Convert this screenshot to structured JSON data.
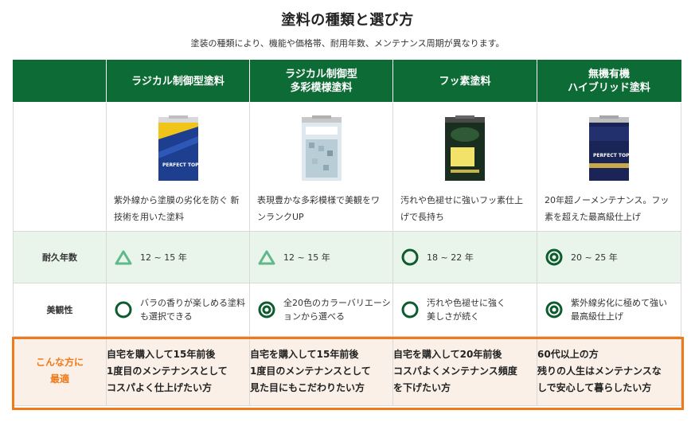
{
  "title": "塗料の種類と選び方",
  "subtitle": "塗装の種類により、機能や価格帯、耐用年数、メンテナンス周期が異なります。",
  "colors": {
    "header_green": "#0d6b35",
    "accent_orange": "#f07a1a",
    "durability_row_bg": "#e9f4ea",
    "best_row_bg": "#faf0e8"
  },
  "row_labels": {
    "durability": "耐久年数",
    "beauty": "美観性",
    "best_for": "こんな方に\n最適"
  },
  "columns": [
    {
      "header": "ラジカル制御型塗料",
      "can_label": "PERFECT TOP",
      "description": "紫外線から塗膜の劣化を防ぐ 新技術を用いた塗料",
      "durability": {
        "icon": "triangle-icon",
        "text": "12 ~ 15 年"
      },
      "beauty": {
        "icon": "circle-icon",
        "text": "バラの香りが楽しめる塗料も選択できる"
      },
      "best_for": "自宅を購入して15年前後\n1度目のメンテナンスとして\nコスパよく仕上げたい方"
    },
    {
      "header": "ラジカル制御型\n多彩模様塗料",
      "can_label": "",
      "description": "表現豊かな多彩模様で美観をワンランクUP",
      "durability": {
        "icon": "triangle-icon",
        "text": "12 ~ 15 年"
      },
      "beauty": {
        "icon": "double-circle-icon",
        "text": "全20色のカラーバリエーションから選べる"
      },
      "best_for": "自宅を購入して15年前後\n1度目のメンテナンスとして\n見た目にもこだわりたい方"
    },
    {
      "header": "フッ素塗料",
      "can_label": "",
      "description": "汚れや色褪せに強いフッ素仕上げで長持ち",
      "durability": {
        "icon": "circle-icon",
        "text": "18 ~ 22 年"
      },
      "beauty": {
        "icon": "circle-icon",
        "text": "汚れや色褪せに強く\n美しさが続く"
      },
      "best_for": "自宅を購入して20年前後\nコスパよくメンテナンス頻度\nを下げたい方"
    },
    {
      "header": "無機有機\nハイブリッド塗料",
      "can_label": "PERFECT TOP",
      "description": "20年超ノーメンテナンス。フッ素を超えた最高級仕上げ",
      "durability": {
        "icon": "double-circle-icon",
        "text": "20 ~ 25 年"
      },
      "beauty": {
        "icon": "double-circle-icon",
        "text": "紫外線劣化に極めて強い\n最高級仕上げ"
      },
      "best_for": "60代以上の方\n残りの人生はメンテナンスな\nしで安心して暮らしたい方"
    }
  ]
}
